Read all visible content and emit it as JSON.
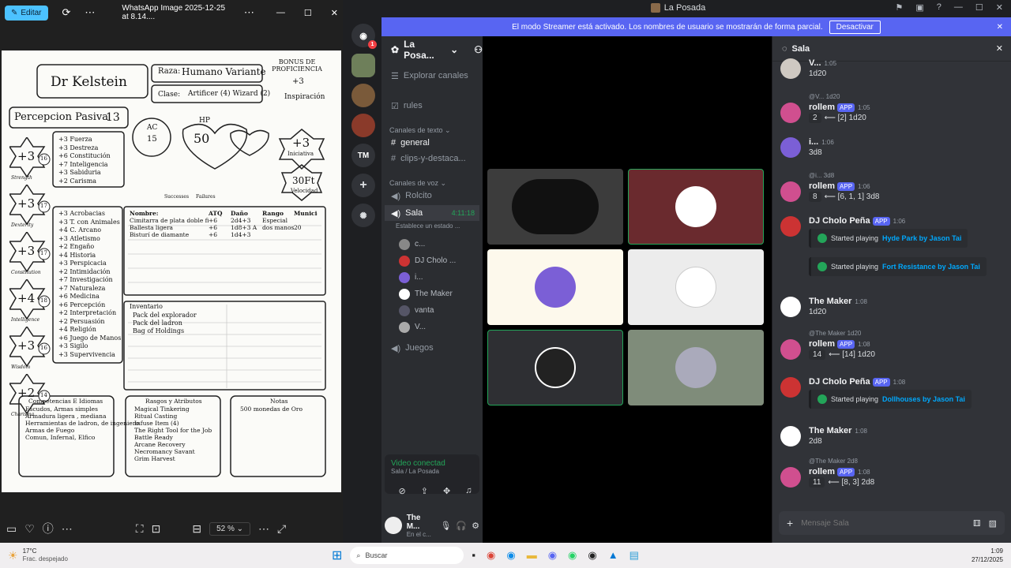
{
  "viewer": {
    "edit_label": "Editar",
    "file_name": "WhatsApp Image 2025-12-25 at 8.14....",
    "zoom": "52 %",
    "sheet": {
      "name": "Dr Kelstein",
      "race_label": "Raza:",
      "race": "Humano Variante",
      "class_label": "Clase:",
      "class": "Artificer (4) Wizard (2)",
      "proficiency_title": "BONUS DE PROFICIENCIA",
      "proficiency": "+3",
      "inspiration": "Inspiración",
      "passive_perception": "Percepcion Pasiva",
      "passive_value": "13",
      "ac_label": "AC",
      "ac": "15",
      "hp_label": "HP",
      "hp": "50",
      "initiative": "+3",
      "initiative_label": "Iniciativa",
      "speed": "30Ft",
      "speed_label": "Velocidad",
      "successes": "Successes",
      "failures": "Failures",
      "abilities": [
        {
          "mod": "+3",
          "score": "16",
          "label": "Strength"
        },
        {
          "mod": "+3",
          "score": "17",
          "label": "Dexterity"
        },
        {
          "mod": "+3",
          "score": "17",
          "label": "Constitution"
        },
        {
          "mod": "+4",
          "score": "18",
          "label": "Intelligence"
        },
        {
          "mod": "+3",
          "score": "16",
          "label": "Wisdom"
        },
        {
          "mod": "+2",
          "score": "14",
          "label": "Charisma"
        }
      ],
      "saves": [
        "+3 Fuerza",
        "+3 Destreza",
        "+6 Constitución",
        "+7 Inteligencia",
        "+3 Sabiduria",
        "+2 Carisma"
      ],
      "skills": [
        "+3 Acrobacias",
        "+3 T. con Animales",
        "+4 C. Arcano",
        "+3 Atletismo",
        "+2 Engaño",
        "+4 Historia",
        "+3 Perspicacia",
        "+2 Intimidación",
        "+7 Investigación",
        "+7 Naturaleza",
        "+6 Medicina",
        "+6 Percepción",
        "+2 Interpretación",
        "+2 Persuasión",
        "+4 Religión",
        "+6 Juego de Manos",
        "+3 Sigilo",
        "+3 Supervivencia"
      ],
      "attacks_headers": [
        "Nombre:",
        "ATQ",
        "Daño",
        "Rango",
        "Munición"
      ],
      "attacks": [
        [
          "Cimitarra de plata doble filo",
          "+6",
          "2d4+3",
          "Especial",
          ""
        ],
        [
          "Ballesta ligera",
          "+6",
          "1d8+3 A",
          "dos manos",
          "20"
        ],
        [
          "Bisturí de diamante",
          "+6",
          "1d4+3",
          "",
          ""
        ]
      ],
      "inventory_title": "Inventario",
      "inventory": [
        "Pack del explorador",
        "Pack del ladron",
        "Bag of Holdings"
      ],
      "prof_title": "Competencias E Idiomas",
      "prof": [
        "Escudos, Armas simples",
        "Armadura ligera , mediana",
        "Herramientas de ladron, de ingeniero",
        "Armas de Fuego",
        "Comun, Infernal, Elfico"
      ],
      "feats_title": "Rasgos y Atributos",
      "feats": [
        "Magical Tinkering",
        "Ritual Casting",
        "Infuse Item (4)",
        "The Right Tool for the Job",
        "Battle Ready",
        "Arcane Recovery",
        "Necromancy Savant",
        "Grim Harvest"
      ],
      "notes_title": "Notas",
      "notes": [
        "500 monedas de Oro"
      ]
    }
  },
  "discord": {
    "window_title": "La Posada",
    "banner_text": "El modo Streamer está activado. Los nombres de usuario se mostrarán de forma parcial.",
    "banner_button": "Desactivar",
    "server_name": "La Posa...",
    "explore": "Explorar canales",
    "rules": "rules",
    "text_category": "Canales de texto",
    "text_channels": [
      "general",
      "clips-y-destaca..."
    ],
    "voice_category": "Canales de voz",
    "voice_channels": [
      "Rolcito",
      "Sala",
      "Juegos"
    ],
    "sala_time": "4:11:18",
    "sala_status": "Establece un estado ...",
    "voice_members": [
      "c...",
      "DJ Cholo ...",
      "i...",
      "The Maker",
      "vanta",
      "V..."
    ],
    "voice_connected": "Video conectad",
    "voice_location": "Sala / La Posada",
    "user_name": "The M...",
    "user_status": "En el c...",
    "chat_title": "Sala",
    "chat_placeholder": "Mensaje Sala",
    "messages": [
      {
        "user": "V...",
        "time": "1:05",
        "text": "1d20"
      },
      {
        "reply": "@V... 1d20",
        "user": "rollem",
        "app": "APP",
        "time": "1:05",
        "roll": "2",
        "text": "⟵ [2] 1d20"
      },
      {
        "user": "i...",
        "time": "1:06",
        "text": "3d8"
      },
      {
        "reply": "@i... 3d8",
        "user": "rollem",
        "app": "APP",
        "time": "1:06",
        "roll": "8",
        "text": "⟵ [6, 1, 1] 3d8"
      },
      {
        "user": "DJ Cholo Peña",
        "app": "APP",
        "time": "1:06",
        "embeds": [
          {
            "prefix": "Started playing",
            "link": "Hyde Park by Jason Tai"
          },
          {
            "prefix": "Started playing",
            "link": "Fort Resistance by Jason Tai"
          }
        ]
      },
      {
        "user": "The Maker",
        "time": "1:08",
        "text": "1d20"
      },
      {
        "reply": "@The Maker 1d20",
        "user": "rollem",
        "app": "APP",
        "time": "1:08",
        "roll": "14",
        "text": "⟵ [14] 1d20"
      },
      {
        "user": "DJ Cholo Peña",
        "app": "APP",
        "time": "1:08",
        "embeds": [
          {
            "prefix": "Started playing",
            "link": "Dollhouses by Jason Tai"
          }
        ]
      },
      {
        "user": "The Maker",
        "time": "1:08",
        "text": "2d8"
      },
      {
        "reply": "@The Maker 2d8",
        "user": "rollem",
        "app": "APP",
        "time": "1:08",
        "roll": "11",
        "text": "⟵ [8, 3] 2d8"
      }
    ]
  },
  "taskbar": {
    "weather_temp": "17°C",
    "weather_desc": "Frac. despejado",
    "search": "Buscar",
    "time": "1:09",
    "date": "27/12/2025"
  }
}
